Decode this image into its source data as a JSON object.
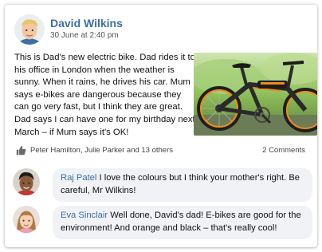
{
  "post": {
    "author": "David Wilkins",
    "timestamp": "30 June at 2:40 pm",
    "text": "This is Dad's new electric bike. Dad rides it to his office in London when the weather is sunny. When it rains, he drives his car. Mum says e-bikes are dangerous because they can go very fast, but I think they are great. Dad says I can have one for my birthday next March – if Mum says it's OK!",
    "image": "electric-bike-photo",
    "likes_text": "Peter Hamilton, Julie Parker and 13 others",
    "comments_count": "2 Comments"
  },
  "comments": [
    {
      "author": "Raj Patel",
      "text": "I love the colours but I think your mother's right. Be careful, Mr Wilkins!"
    },
    {
      "author": "Eva Sinclair",
      "text": "Well done, David's dad! E-bikes are good for the environment! And orange and black – that's really cool!"
    }
  ],
  "colors": {
    "link": "#3c6ea5",
    "bubble": "#f0f2f5",
    "bike_accent": "#f08a1c"
  },
  "icons": {
    "like": "thumbs-up-icon"
  }
}
